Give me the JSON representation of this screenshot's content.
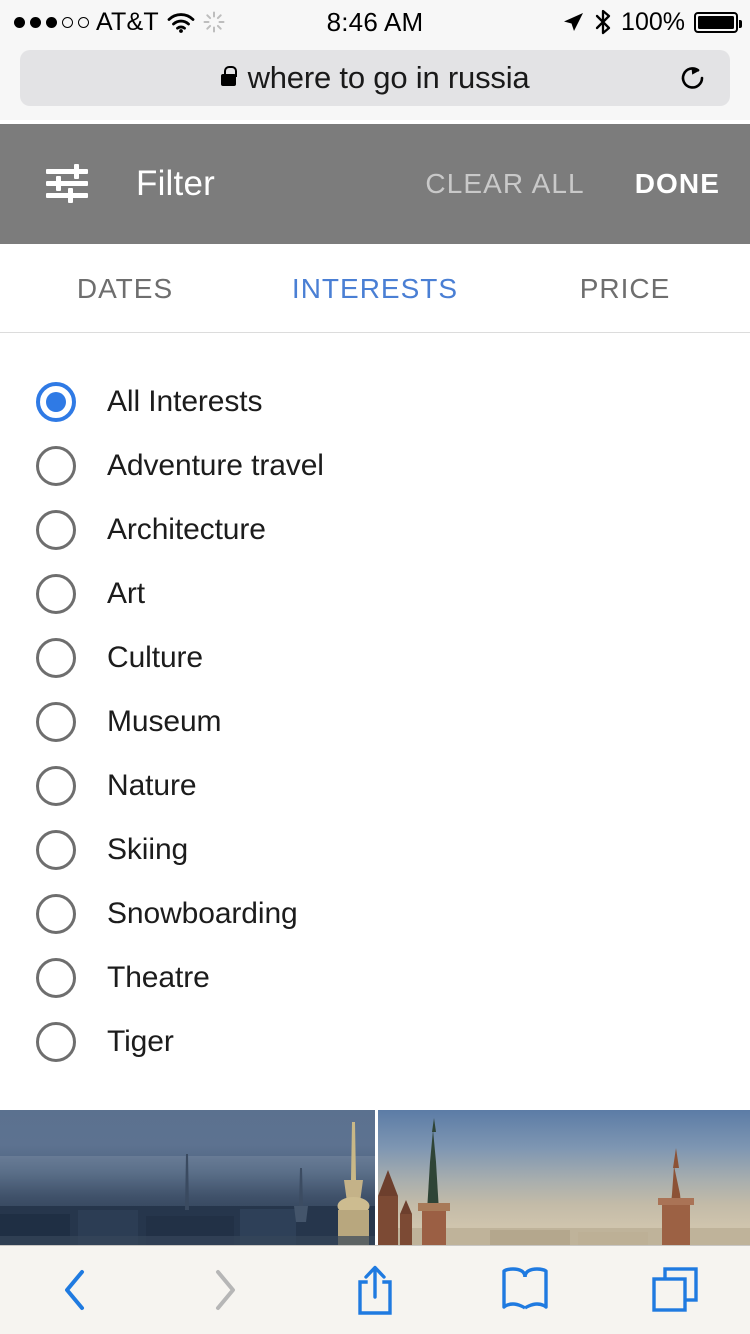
{
  "status_bar": {
    "signal_dots_filled": 3,
    "signal_dots_total": 5,
    "carrier": "AT&T",
    "wifi_icon": "wifi-icon",
    "activity_icon": "activity-spinner-icon",
    "time": "8:46 AM",
    "location_icon": "location-arrow-icon",
    "bluetooth_icon": "bluetooth-icon",
    "battery_percent": "100%",
    "battery_icon": "battery-full-icon"
  },
  "browser": {
    "lock_icon": "lock-icon",
    "url_text": "where to go in russia",
    "url_placeholder": "Search or enter website name",
    "reload_icon": "reload-icon"
  },
  "filter_header": {
    "filter_icon": "sliders-icon",
    "title": "Filter",
    "clear_all_label": "CLEAR ALL",
    "done_label": "DONE",
    "background_color": "#7c7c7c",
    "clear_all_color": "#c9c9c9",
    "done_color": "#ffffff"
  },
  "tabs": {
    "active_index": 1,
    "active_color": "#4a7fd4",
    "inactive_color": "#6e6e6e",
    "items": [
      {
        "label": "DATES"
      },
      {
        "label": "INTERESTS"
      },
      {
        "label": "PRICE"
      }
    ]
  },
  "interests": {
    "selected_index": 0,
    "selected_color": "#2f7ae5",
    "unselected_color": "#6e6e6e",
    "options": [
      {
        "label": "All Interests"
      },
      {
        "label": "Adventure travel"
      },
      {
        "label": "Architecture"
      },
      {
        "label": "Art"
      },
      {
        "label": "Culture"
      },
      {
        "label": "Museum"
      },
      {
        "label": "Nature"
      },
      {
        "label": "Skiing"
      },
      {
        "label": "Snowboarding"
      },
      {
        "label": "Theatre"
      },
      {
        "label": "Tiger"
      }
    ]
  },
  "photos": [
    {
      "name": "saint-petersburg-skyline-photo"
    },
    {
      "name": "moscow-kremlin-towers-photo"
    }
  ],
  "toolbar": {
    "back_icon": "back-chevron-icon",
    "forward_icon": "forward-chevron-icon",
    "share_icon": "share-icon",
    "bookmarks_icon": "book-icon",
    "tabs_icon": "tabs-icon",
    "enabled_color": "#1f7ae0",
    "disabled_color": "#b6b6b6"
  }
}
